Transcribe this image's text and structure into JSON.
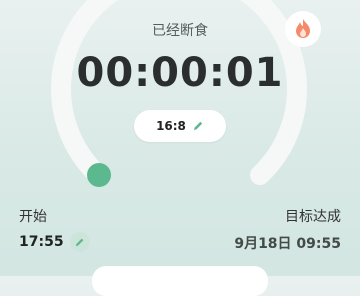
{
  "status": {
    "label": "已经断食"
  },
  "timer": {
    "elapsed": "00:00:01"
  },
  "plan": {
    "label": "16:8",
    "edit_icon": "pencil-icon"
  },
  "flame": {
    "icon": "fire-icon"
  },
  "progress": {
    "fraction": 0.0
  },
  "start": {
    "label": "开始",
    "time": "17:55",
    "edit_icon": "pencil-icon"
  },
  "goal": {
    "label": "目标达成",
    "time": "9月18日 09:55"
  },
  "colors": {
    "accent": "#5cb88e",
    "ring": "#f5f8f7",
    "background": "#dfecea",
    "text_dark": "#2b2e2e"
  }
}
